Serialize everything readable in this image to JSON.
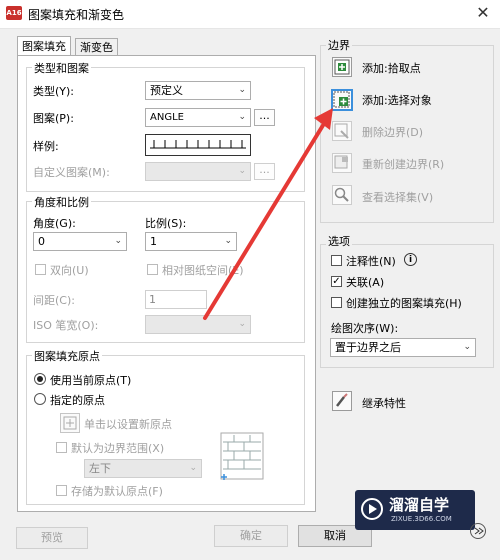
{
  "window": {
    "app_icon_text": "A16",
    "title": "图案填充和渐变色",
    "close_glyph": "✕"
  },
  "tabs": [
    {
      "label": "图案填充"
    },
    {
      "label": "渐变色"
    }
  ],
  "type_pattern": {
    "legend": "类型和图案",
    "type_label": "类型(Y):",
    "type_value": "预定义",
    "pattern_label": "图案(P):",
    "pattern_value": "ANGLE",
    "pattern_browse": "...",
    "swatch_label": "样例:",
    "custom_label": "自定义图案(M):",
    "custom_browse": "..."
  },
  "angle_scale": {
    "legend": "角度和比例",
    "angle_label": "角度(G):",
    "angle_value": "0",
    "scale_label": "比例(S):",
    "scale_value": "1",
    "double_label": "双向(U)",
    "relative_label": "相对图纸空间(E)",
    "spacing_label": "间距(C):",
    "spacing_value": "1",
    "iso_label": "ISO 笔宽(O):"
  },
  "origin": {
    "legend": "图案填充原点",
    "use_current_label": "使用当前原点(T)",
    "specified_label": "指定的原点",
    "click_set_label": "单击以设置新原点",
    "default_extent_label": "默认为边界范围(X)",
    "extent_value": "左下",
    "store_default_label": "存储为默认原点(F)"
  },
  "boundary": {
    "legend": "边界",
    "add_pick_label": "添加:拾取点",
    "add_select_label": "添加:选择对象",
    "remove_label": "删除边界(D)",
    "recreate_label": "重新创建边界(R)",
    "view_label": "查看选择集(V)"
  },
  "options": {
    "legend": "选项",
    "annotative_label": "注释性(N)",
    "info_glyph": "i",
    "associative_label": "关联(A)",
    "separate_label": "创建独立的图案填充(H)",
    "draw_order_label": "绘图次序(W):",
    "draw_order_value": "置于边界之后"
  },
  "inherit_label": "继承特性",
  "bottom": {
    "preview": "预览",
    "ok": "确定",
    "cancel": "取消"
  },
  "watermark": {
    "brand": "溜溜自学",
    "url": "ZIXUE.3D66.COM"
  },
  "colors": {
    "arrow": "#e53935",
    "selected_border": "#3b8fdc",
    "watermark_bg": "#1e2a4a"
  }
}
